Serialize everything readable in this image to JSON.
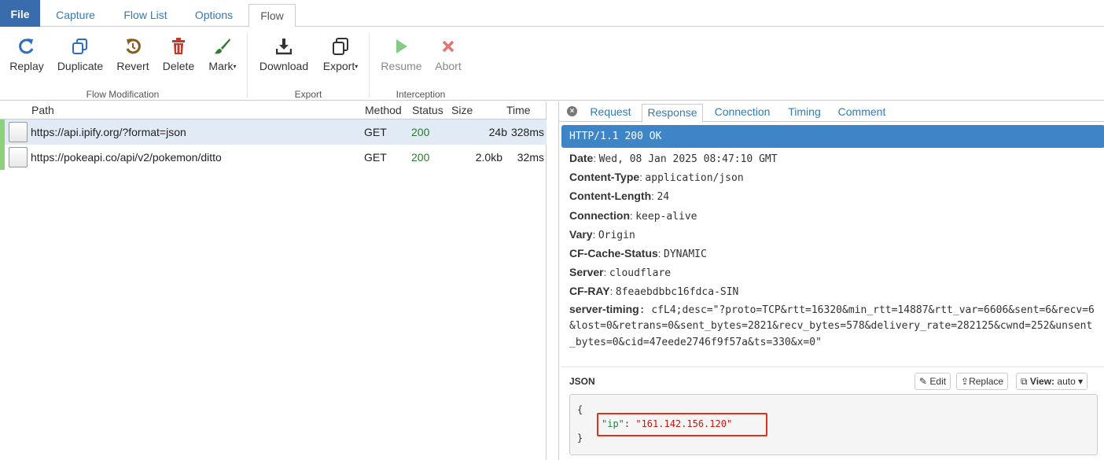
{
  "menu": {
    "tabs": [
      {
        "label": "File"
      },
      {
        "label": "Capture"
      },
      {
        "label": "Flow List"
      },
      {
        "label": "Options"
      },
      {
        "label": "Flow"
      }
    ]
  },
  "ribbon": {
    "buttons": {
      "replay": "Replay",
      "duplicate": "Duplicate",
      "revert": "Revert",
      "delete": "Delete",
      "mark": "Mark",
      "download": "Download",
      "export": "Export",
      "resume": "Resume",
      "abort": "Abort"
    },
    "groups": {
      "modification": "Flow Modification",
      "export": "Export",
      "interception": "Interception"
    },
    "colors": {
      "replay": "#2d6fbf",
      "revert": "#8a5a1e",
      "delete": "#c0392b",
      "mark": "#2e7d32",
      "resume": "#5cb85c",
      "abort": "#d9534f"
    }
  },
  "flowtable": {
    "columns": {
      "path": "Path",
      "method": "Method",
      "status": "Status",
      "size": "Size",
      "time": "Time"
    },
    "rows": [
      {
        "path": "https://api.ipify.org/?format=json",
        "method": "GET",
        "status": "200",
        "size": "24b",
        "time": "328ms"
      },
      {
        "path": "https://pokeapi.co/api/v2/pokemon/ditto",
        "method": "GET",
        "status": "200",
        "size": "2.0kb",
        "time": "32ms"
      }
    ]
  },
  "detail": {
    "tabs": [
      "Request",
      "Response",
      "Connection",
      "Timing",
      "Comment"
    ],
    "status_line": "HTTP/1.1 200 OK",
    "headers": [
      {
        "key": "Date",
        "value": "Wed, 08 Jan 2025 08:47:10 GMT"
      },
      {
        "key": "Content-Type",
        "value": "application/json"
      },
      {
        "key": "Content-Length",
        "value": "24"
      },
      {
        "key": "Connection",
        "value": "keep-alive"
      },
      {
        "key": "Vary",
        "value": "Origin"
      },
      {
        "key": "CF-Cache-Status",
        "value": "DYNAMIC"
      },
      {
        "key": "Server",
        "value": "cloudflare"
      },
      {
        "key": "CF-RAY",
        "value": "8feaebdbbc16fdca-SIN"
      }
    ],
    "server_timing": {
      "key": "server-timing",
      "value": "cfL4;desc=\"?proto=TCP&rtt=16320&min_rtt=14887&rtt_var=6606&sent=6&recv=6&lost=0&retrans=0&sent_bytes=2821&recv_bytes=578&delivery_rate=282125&cwnd=252&unsent_bytes=0&cid=47eede2746f9f57a&ts=330&x=0\""
    },
    "content": {
      "label": "JSON",
      "edit": "Edit",
      "replace": "Replace",
      "view_prefix": "View:",
      "view_value": "auto",
      "json_open": "{",
      "json_key": "\"ip\"",
      "json_sep": ": ",
      "json_value": "\"161.142.156.120\"",
      "json_close": "}"
    },
    "highlight_color": "#e0301e"
  }
}
